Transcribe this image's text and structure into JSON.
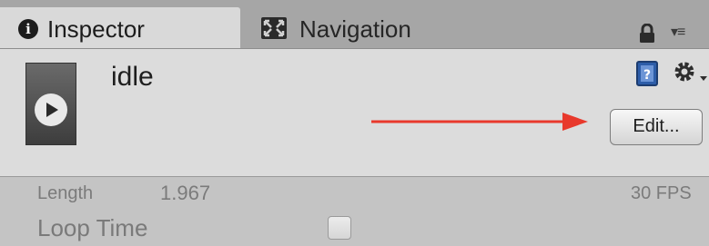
{
  "tabs": {
    "inspector": {
      "label": "Inspector",
      "icon": "info-icon"
    },
    "navigation": {
      "label": "Navigation",
      "icon": "navigation-icon"
    }
  },
  "header": {
    "clip_name": "idle",
    "edit_label": "Edit..."
  },
  "properties": {
    "length_label": "Length",
    "length_value": "1.967",
    "fps": "30 FPS",
    "loop_time_label": "Loop Time",
    "loop_time_checked": false
  },
  "colors": {
    "annotation_arrow": "#e8392c"
  }
}
